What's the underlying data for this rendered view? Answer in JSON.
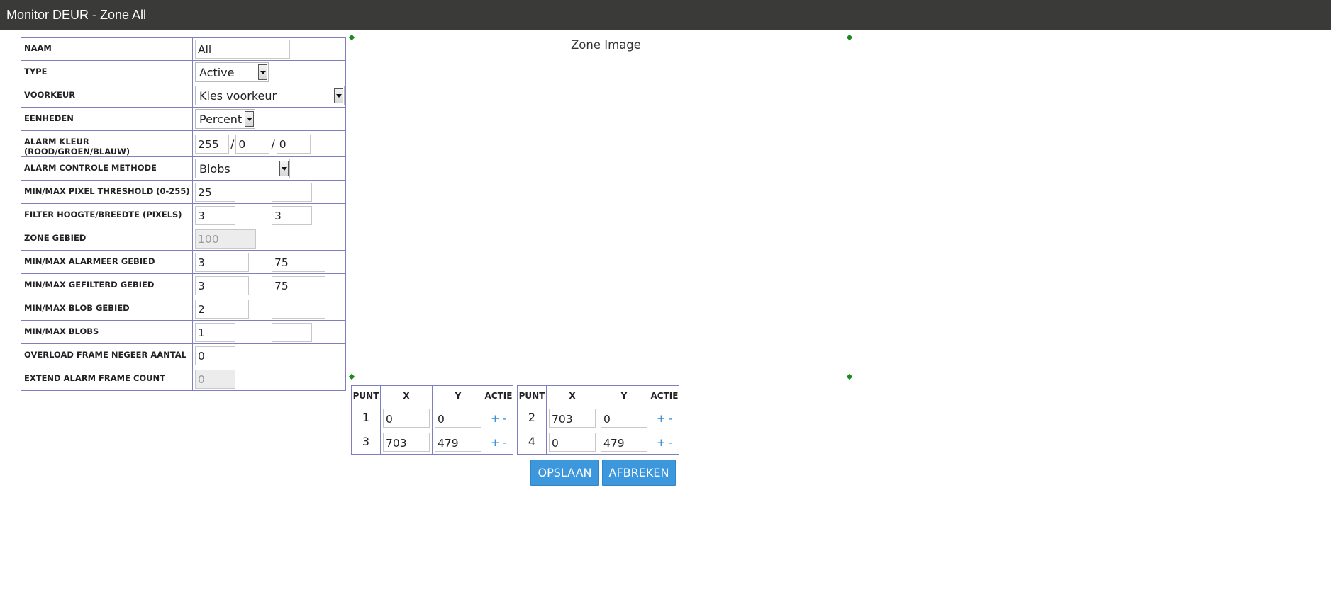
{
  "window": {
    "title": "Monitor DEUR - Zone All"
  },
  "settings": {
    "name": {
      "label": "NAAM",
      "value": "All"
    },
    "type": {
      "label": "TYPE",
      "value": "Active"
    },
    "preset": {
      "label": "VOORKEUR",
      "value": "Kies voorkeur"
    },
    "units": {
      "label": "EENHEDEN",
      "value": "Percent"
    },
    "alarm_color": {
      "label": "ALARM KLEUR (ROOD/GROEN/BLAUW)",
      "red": "255",
      "green": "0",
      "blue": "0",
      "separator": "/"
    },
    "check_method": {
      "label": "ALARM CONTROLE METHODE",
      "value": "Blobs"
    },
    "pixel_threshold": {
      "label": "MIN/MAX PIXEL THRESHOLD (0-255)",
      "min": "25",
      "max": ""
    },
    "filter_size": {
      "label": "FILTER HOOGTE/BREEDTE (PIXELS)",
      "height": "3",
      "width": "3"
    },
    "zone_area": {
      "label": "ZONE GEBIED",
      "value": "100"
    },
    "alarm_area": {
      "label": "MIN/MAX ALARMEER GEBIED",
      "min": "3",
      "max": "75"
    },
    "filtered_area": {
      "label": "MIN/MAX GEFILTERD GEBIED",
      "min": "3",
      "max": "75"
    },
    "blob_area": {
      "label": "MIN/MAX BLOB GEBIED",
      "min": "2",
      "max": ""
    },
    "blobs": {
      "label": "MIN/MAX BLOBS",
      "min": "1",
      "max": ""
    },
    "overload_frames": {
      "label": "OVERLOAD FRAME NEGEER AANTAL",
      "value": "0"
    },
    "extend_alarm_frames": {
      "label": "EXTEND ALARM FRAME COUNT",
      "value": "0"
    }
  },
  "zone_image": {
    "label": "Zone Image"
  },
  "points": {
    "headers": {
      "point": "PUNT",
      "x": "X",
      "y": "Y",
      "action": "ACTIE"
    },
    "plus": "+",
    "minus": "-",
    "items": [
      {
        "n": "1",
        "x": "0",
        "y": "0"
      },
      {
        "n": "2",
        "x": "703",
        "y": "0"
      },
      {
        "n": "3",
        "x": "703",
        "y": "479"
      },
      {
        "n": "4",
        "x": "0",
        "y": "479"
      }
    ]
  },
  "buttons": {
    "save": "OPSLAAN",
    "cancel": "AFBREKEN"
  }
}
